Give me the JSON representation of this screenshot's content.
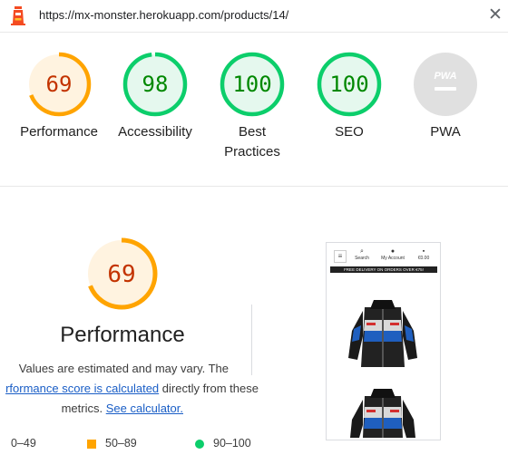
{
  "topbar": {
    "url": "https://mx-monster.herokuapp.com/products/14/",
    "logo_icon": "lighthouse-icon",
    "close_icon": "close-icon",
    "close_glyph": "✕"
  },
  "colors": {
    "average": "#ffa400",
    "average_text": "#c33300",
    "average_bg": "#fff3e0",
    "pass": "#0cce6b",
    "pass_text": "#008800",
    "pass_bg": "#e5f8ee",
    "na": "#e0e0e0",
    "link": "#1a5ec6"
  },
  "categories": [
    {
      "name": "performance",
      "label": "Performance",
      "score": "69",
      "value": 69,
      "rating": "average"
    },
    {
      "name": "accessibility",
      "label": "Accessibility",
      "score": "98",
      "value": 98,
      "rating": "pass"
    },
    {
      "name": "best-practices",
      "label": "Best Practices",
      "label_line1": "Best",
      "label_line2": "Practices",
      "score": "100",
      "value": 100,
      "rating": "pass"
    },
    {
      "name": "seo",
      "label": "SEO",
      "score": "100",
      "value": 100,
      "rating": "pass"
    },
    {
      "name": "pwa",
      "label": "PWA",
      "badge_text": "PWA",
      "rating": "na"
    }
  ],
  "perf": {
    "score": "69",
    "value": 69,
    "title": "Performance",
    "desc_part1": "Values are estimated and may vary. The",
    "desc_link1": "rformance score is calculated",
    "desc_part2": " directly from these",
    "desc_part3": "metrics. ",
    "desc_link2": "See calculator."
  },
  "legend": {
    "fail_range": "0–49",
    "average_range": "50–89",
    "pass_range": "90–100"
  },
  "thumbnail": {
    "menu_icon": "menu-icon",
    "search_label": "Search",
    "account_label": "My Account",
    "cart_label": "€0.00",
    "banner": "FREE DELIVERY ON ORDERS OVER €75!"
  }
}
